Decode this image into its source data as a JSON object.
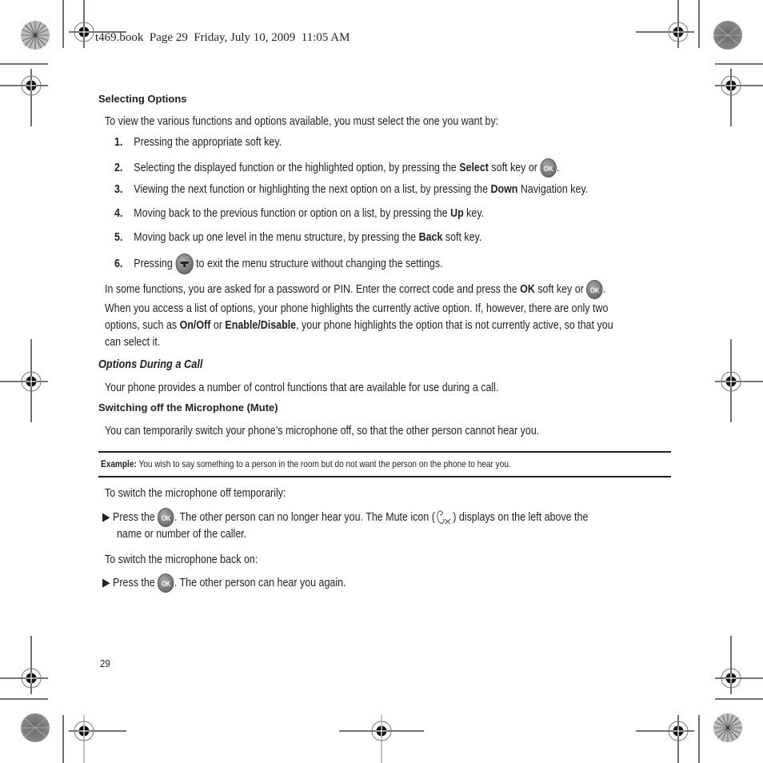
{
  "header": {
    "text": "t469.book  Page 29  Friday, July 10, 2009  11:05 AM"
  },
  "sections": {
    "selecting_options": {
      "title": "Selecting Options",
      "intro": "To view the various functions and options available, you must select the one you want by:",
      "steps": [
        {
          "num": "1.",
          "pre": "Pressing the appropriate soft key.",
          "bold": "",
          "post": ""
        },
        {
          "num": "2.",
          "pre": "Selecting the displayed function or the highlighted option, by pressing the ",
          "bold": "Select",
          "post": " soft key or ",
          "icon": "ok-button-icon",
          "tail": "."
        },
        {
          "num": "3.",
          "pre": "Viewing the next function or highlighting the next option on a list, by pressing the ",
          "bold": "Down",
          "post": " Navigation key."
        },
        {
          "num": "4.",
          "pre": "Moving back to the previous function or option on a list, by pressing the ",
          "bold": "Up",
          "post": " key."
        },
        {
          "num": "5.",
          "pre": "Moving back up one level in the menu structure, by pressing the ",
          "bold": "Back",
          "post": " soft key."
        },
        {
          "num": "6.",
          "pre": "Pressing ",
          "icon": "end-key-icon",
          "post": " to exit the menu structure without changing the settings."
        }
      ],
      "pin_para": {
        "pre": "In some functions, you are asked for a password or PIN. Enter the correct code and press the ",
        "bold": "OK",
        "post": " soft key or ",
        "tail": "."
      },
      "list_para": {
        "line1": "When you access a list of options, your phone highlights the currently active option. If, however, there are only two",
        "line2_pre": "options, such as ",
        "bold1": "On/Off",
        "mid": " or ",
        "bold2": "Enable/Disable",
        "line2_post": ", your phone highlights the option that is not currently active, so that you",
        "line3": "can select it."
      }
    },
    "options_during_call": {
      "title": "Options During a Call",
      "intro": "Your phone provides a number of control functions that are available for use during a call."
    },
    "mute": {
      "title": "Switching off the Microphone (Mute)",
      "intro": "You can temporarily switch your phone’s microphone off, so that the other person cannot hear you.",
      "example_label": "Example:",
      "example_text": " You wish to say something to a person in the room but do not want the person on the phone to hear you.",
      "off_heading": "To switch the microphone off temporarily:",
      "off_bullet": {
        "pre": "Press the ",
        "post": ". The other person can no longer hear you. The Mute icon (",
        "post2": ") displays on the left above the",
        "line2": "name or number of the caller."
      },
      "on_heading": "To switch the microphone back on:",
      "on_bullet": {
        "pre": "Press the ",
        "post": ". The other person can hear you again."
      }
    }
  },
  "ok_label": "OK",
  "page_number": "29"
}
